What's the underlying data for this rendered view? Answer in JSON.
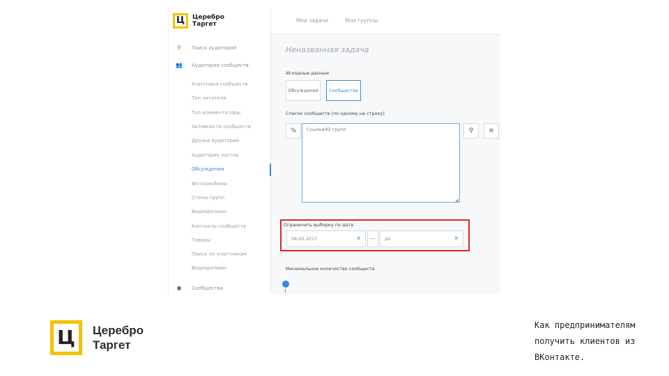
{
  "app": {
    "brand_line1": "Церебро",
    "brand_line2": "Таргет",
    "brand_glyph": "Ц",
    "accent_color": "#f2c300",
    "link_color": "#3a8ad6",
    "highlight_color": "#d8262c"
  },
  "topbar": {
    "tabs": [
      "Мои задачи",
      "Мои группы"
    ]
  },
  "sidebar": {
    "items": [
      {
        "icon": "search-icon",
        "glyph": "⚲",
        "label": "Поиск аудиторий"
      },
      {
        "icon": "users-icon",
        "glyph": "👥",
        "label": "Аудитория сообществ"
      }
    ],
    "sub_items": [
      "Участники сообществ",
      "Топ читатели",
      "Топ комментаторы",
      "Активности сообществ",
      "Друзья аудитории",
      "Аудитория постов",
      "Обсуждения",
      "Фотоальбомы",
      "Стены групп",
      "Видеоролики",
      "Контакты сообществ",
      "Товары",
      "Поиск по участникам",
      "Видеоролики"
    ],
    "active_sub_index": 6,
    "footer_item": {
      "icon": "chat-icon",
      "glyph": "●",
      "label": "Сообщества"
    }
  },
  "main": {
    "task_title": "Неназванная задача",
    "source_label": "Исходные данные",
    "source_options": [
      "Обсуждения",
      "Сообщества"
    ],
    "source_selected": 1,
    "list_label": "Список сообществ (по одному на строку)",
    "list_placeholder": "Ссылки/ID групп",
    "link_icon_glyph": "%",
    "user_icon_glyph": "⚲",
    "menu_icon_glyph": "≡",
    "date_label": "Ограничить выборку по дате",
    "date_from": "06.05.2017",
    "date_to": "до",
    "date_dash": "—",
    "clear_glyph": "✕",
    "min_count_label": "Минимальное количество сообществ"
  },
  "footer": {
    "brand_line1": "Церебро",
    "brand_line2": "Таргет",
    "brand_glyph": "Ц",
    "caption": "Как предпринимателям получить клиентов из ВКонтакте."
  }
}
